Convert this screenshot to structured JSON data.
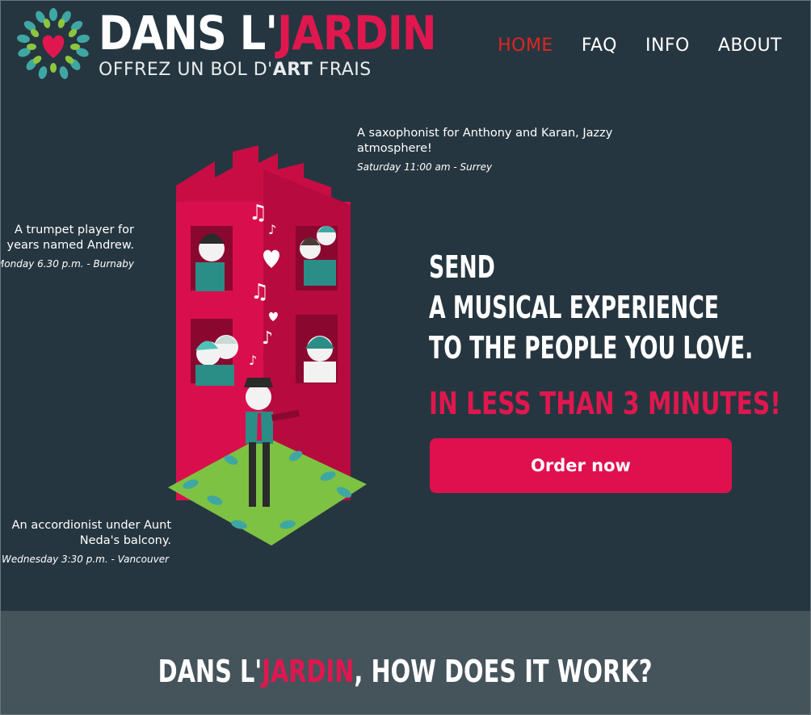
{
  "brand": {
    "title_part1": "DANS L'",
    "title_part2": "JARDIN",
    "tagline_part1": "OFFREZ UN BOL D'",
    "tagline_bold": "ART",
    "tagline_part2": " FRAIS",
    "colors": {
      "accent": "#e0174f",
      "background": "#263640",
      "nav_active": "#e0251f"
    }
  },
  "nav": {
    "items": [
      {
        "label": "HOME",
        "active": true
      },
      {
        "label": "FAQ",
        "active": false
      },
      {
        "label": "INFO",
        "active": false
      },
      {
        "label": "ABOUT",
        "active": false
      }
    ]
  },
  "captions": [
    {
      "text": "A saxophonist for Anthony and Karan, Jazzy atmosphere!",
      "when": "Saturday 11:00 am - Surrey"
    },
    {
      "line1": "A trumpet player for",
      "line2": "years named Andrew.",
      "when": "Monday 6.30 p.m. - Burnaby"
    },
    {
      "line1": "An accordionist under Aunt",
      "line2": "Neda's balcony.",
      "when": "Wednesday 3:30 p.m. - Vancouver"
    }
  ],
  "hero": {
    "line1": "SEND",
    "line2": "A MUSICAL EXPERIENCE",
    "line3": "TO THE PEOPLE YOU LOVE.",
    "subhead": "IN LESS THAN 3 MINUTES!",
    "cta": "Order now"
  },
  "how": {
    "part1": "DANS L'",
    "part2": "JARDIN",
    "part3": ", HOW DOES IT WORK?"
  }
}
